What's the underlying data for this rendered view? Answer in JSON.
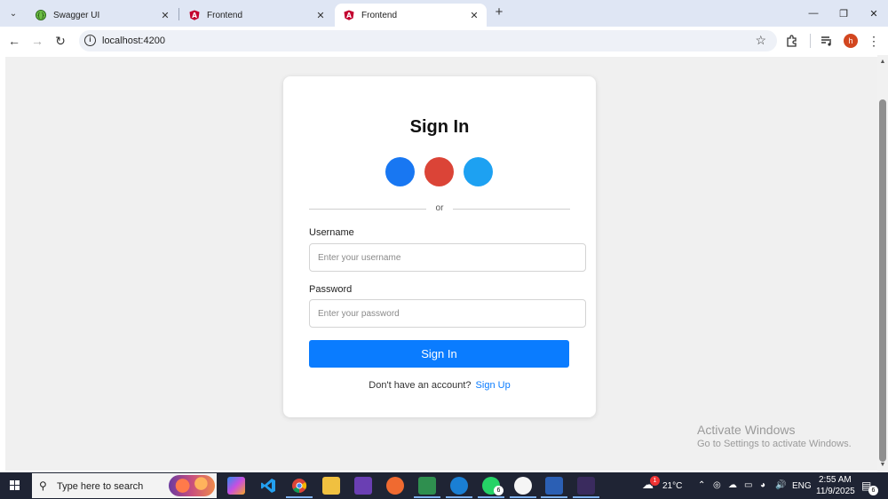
{
  "browser": {
    "tabs": [
      {
        "title": "Swagger UI",
        "icon": "swagger-icon"
      },
      {
        "title": "Frontend",
        "icon": "angular-icon"
      },
      {
        "title": "Frontend",
        "icon": "angular-icon",
        "active": true
      }
    ],
    "url": "localhost:4200",
    "profile_initial": "h",
    "profile_color": "#d2461f"
  },
  "signin": {
    "title": "Sign In",
    "social_buttons": [
      {
        "name": "facebook",
        "color": "#1877f2"
      },
      {
        "name": "google",
        "color": "#db4437"
      },
      {
        "name": "twitter",
        "color": "#1da1f2"
      }
    ],
    "divider_text": "or",
    "username": {
      "label": "Username",
      "placeholder": "Enter your username",
      "value": ""
    },
    "password": {
      "label": "Password",
      "placeholder": "Enter your password",
      "value": ""
    },
    "submit_label": "Sign In",
    "footer_text": "Don't have an account?",
    "footer_link": "Sign Up",
    "accent_color": "#0a7cff"
  },
  "watermark": {
    "title": "Activate Windows",
    "subtitle": "Go to Settings to activate Windows."
  },
  "taskbar": {
    "search_placeholder": "Type here to search",
    "weather_temp": "21°C",
    "language": "ENG",
    "time": "2:55 AM",
    "date": "11/9/2025",
    "weather_badge": "1",
    "whatsapp_badge": "6",
    "notification_badge": "6"
  }
}
